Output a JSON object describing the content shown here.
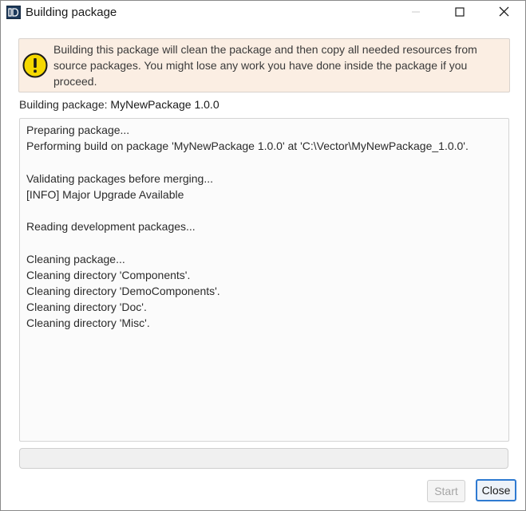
{
  "window": {
    "title": "Building package"
  },
  "titlebar_icons": {
    "app": "package-app-icon",
    "minimize": "minimize-icon",
    "maximize": "maximize-icon",
    "close": "close-icon"
  },
  "warning": {
    "icon": "warning-icon",
    "lines": [
      "Building this package will clean the package and then copy all needed resources from",
      "source packages. You might lose any work you have done inside the package if you",
      "proceed."
    ]
  },
  "package": {
    "label": "Building package:",
    "value": "MyNewPackage 1.0.0"
  },
  "log": {
    "lines": [
      "Preparing package...",
      "Performing build on package 'MyNewPackage 1.0.0' at 'C:\\Vector\\MyNewPackage_1.0.0'.",
      "",
      "Validating packages before merging...",
      "[INFO] Major Upgrade Available",
      "",
      "Reading development packages...",
      "",
      "Cleaning package...",
      "Cleaning directory 'Components'.",
      "Cleaning directory 'DemoComponents'.",
      "Cleaning directory 'Doc'.",
      "Cleaning directory 'Misc'."
    ]
  },
  "progress": {
    "value": 0
  },
  "buttons": {
    "start": "Start",
    "close": "Close"
  },
  "colors": {
    "warning_bg": "#fbeee3",
    "warning_icon": "#f5d800",
    "accent": "#2e7ad1"
  }
}
